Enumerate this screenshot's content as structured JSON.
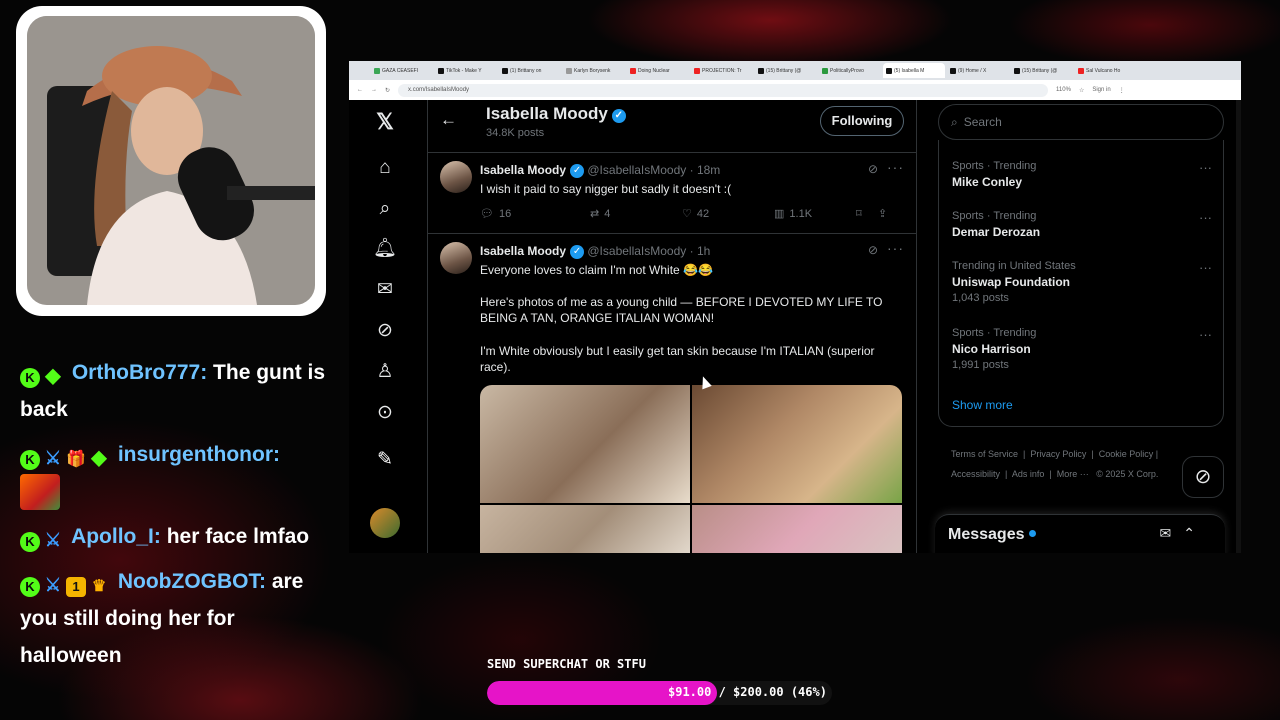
{
  "stream": {
    "chat": [
      {
        "username": "OrthoBro777:",
        "text": "The gunt is back",
        "badges": [
          "kick-verified",
          "diamond"
        ]
      },
      {
        "username": "insurgenthonor:",
        "text": "",
        "emote": "pepe-fire-emote",
        "badges": [
          "kick-verified",
          "sword",
          "gift",
          "diamond"
        ]
      },
      {
        "username": "Apollo_I:",
        "text": "her face lmfao",
        "badges": [
          "kick-verified",
          "sword"
        ]
      },
      {
        "username": "NoobZOGBOT:",
        "text": "are you still doing her for halloween",
        "badges": [
          "kick-verified",
          "sword",
          "sub-badge",
          "crown"
        ]
      }
    ],
    "superchat": {
      "label": "SEND SUPERCHAT OR STFU",
      "amount_text": "$91.00 / $200.00 (46%)",
      "progress_fraction": 0.46,
      "fill_color": "#e614c8"
    }
  },
  "browser": {
    "tabs": [
      {
        "label": "GAZA CEASEFI",
        "active": false
      },
      {
        "label": "TikTok - Make Y",
        "active": false
      },
      {
        "label": "(1) Brittany on",
        "active": false
      },
      {
        "label": "Karlyn Borysenk",
        "active": false
      },
      {
        "label": "Doing Nuclear",
        "active": false
      },
      {
        "label": "PROJECTION: Tr",
        "active": false
      },
      {
        "label": "(15) Brittany (@",
        "active": false
      },
      {
        "label": "PoliticallyProvo",
        "active": false
      },
      {
        "label": "(5) Isabella M",
        "active": true
      },
      {
        "label": "(9) Home / X",
        "active": false
      },
      {
        "label": "(15) Brittany (@",
        "active": false
      },
      {
        "label": "Sal Vulcano Ho",
        "active": false
      }
    ],
    "url": "x.com/IsabellaIsMoody",
    "zoom": "110%",
    "sign_in": "Sign in"
  },
  "profile": {
    "name": "Isabella Moody",
    "posts": "34.8K posts",
    "follow_label": "Following"
  },
  "tweets": [
    {
      "name": "Isabella Moody",
      "handle": "@IsabellaIsMoody",
      "time": "18m",
      "text": "I wish it paid to say nigger but sadly it doesn't :(",
      "replies": "16",
      "reposts": "4",
      "likes": "42",
      "views": "1.1K"
    },
    {
      "name": "Isabella Moody",
      "handle": "@IsabellaIsMoody",
      "time": "1h",
      "text1": "Everyone loves to claim I'm not White 😂😂",
      "text2": "Here's photos of me as a young child — BEFORE I DEVOTED MY LIFE TO BEING A TAN, ORANGE ITALIAN WOMAN!",
      "text3": "I'm White obviously but I easily get tan skin because I'm ITALIAN (superior race)."
    }
  ],
  "sidebar": {
    "search_placeholder": "Search",
    "trends": [
      {
        "context": "Sports · Trending",
        "name": "Mike Conley",
        "count": ""
      },
      {
        "context": "Sports · Trending",
        "name": "Demar Derozan",
        "count": ""
      },
      {
        "context": "Trending in United States",
        "name": "Uniswap Foundation",
        "count": "1,043 posts"
      },
      {
        "context": "Sports · Trending",
        "name": "Nico Harrison",
        "count": "1,991 posts"
      }
    ],
    "show_more": "Show more",
    "footer": {
      "terms": "Terms of Service",
      "privacy": "Privacy Policy",
      "cookie": "Cookie Policy",
      "accessibility": "Accessibility",
      "ads": "Ads info",
      "more": "More ···",
      "copyright": "© 2025 X Corp."
    },
    "messages_title": "Messages"
  },
  "colors": {
    "accent": "#1d9bf0",
    "chat_username": "#6fc3ff",
    "kick_green": "#53fc18"
  }
}
